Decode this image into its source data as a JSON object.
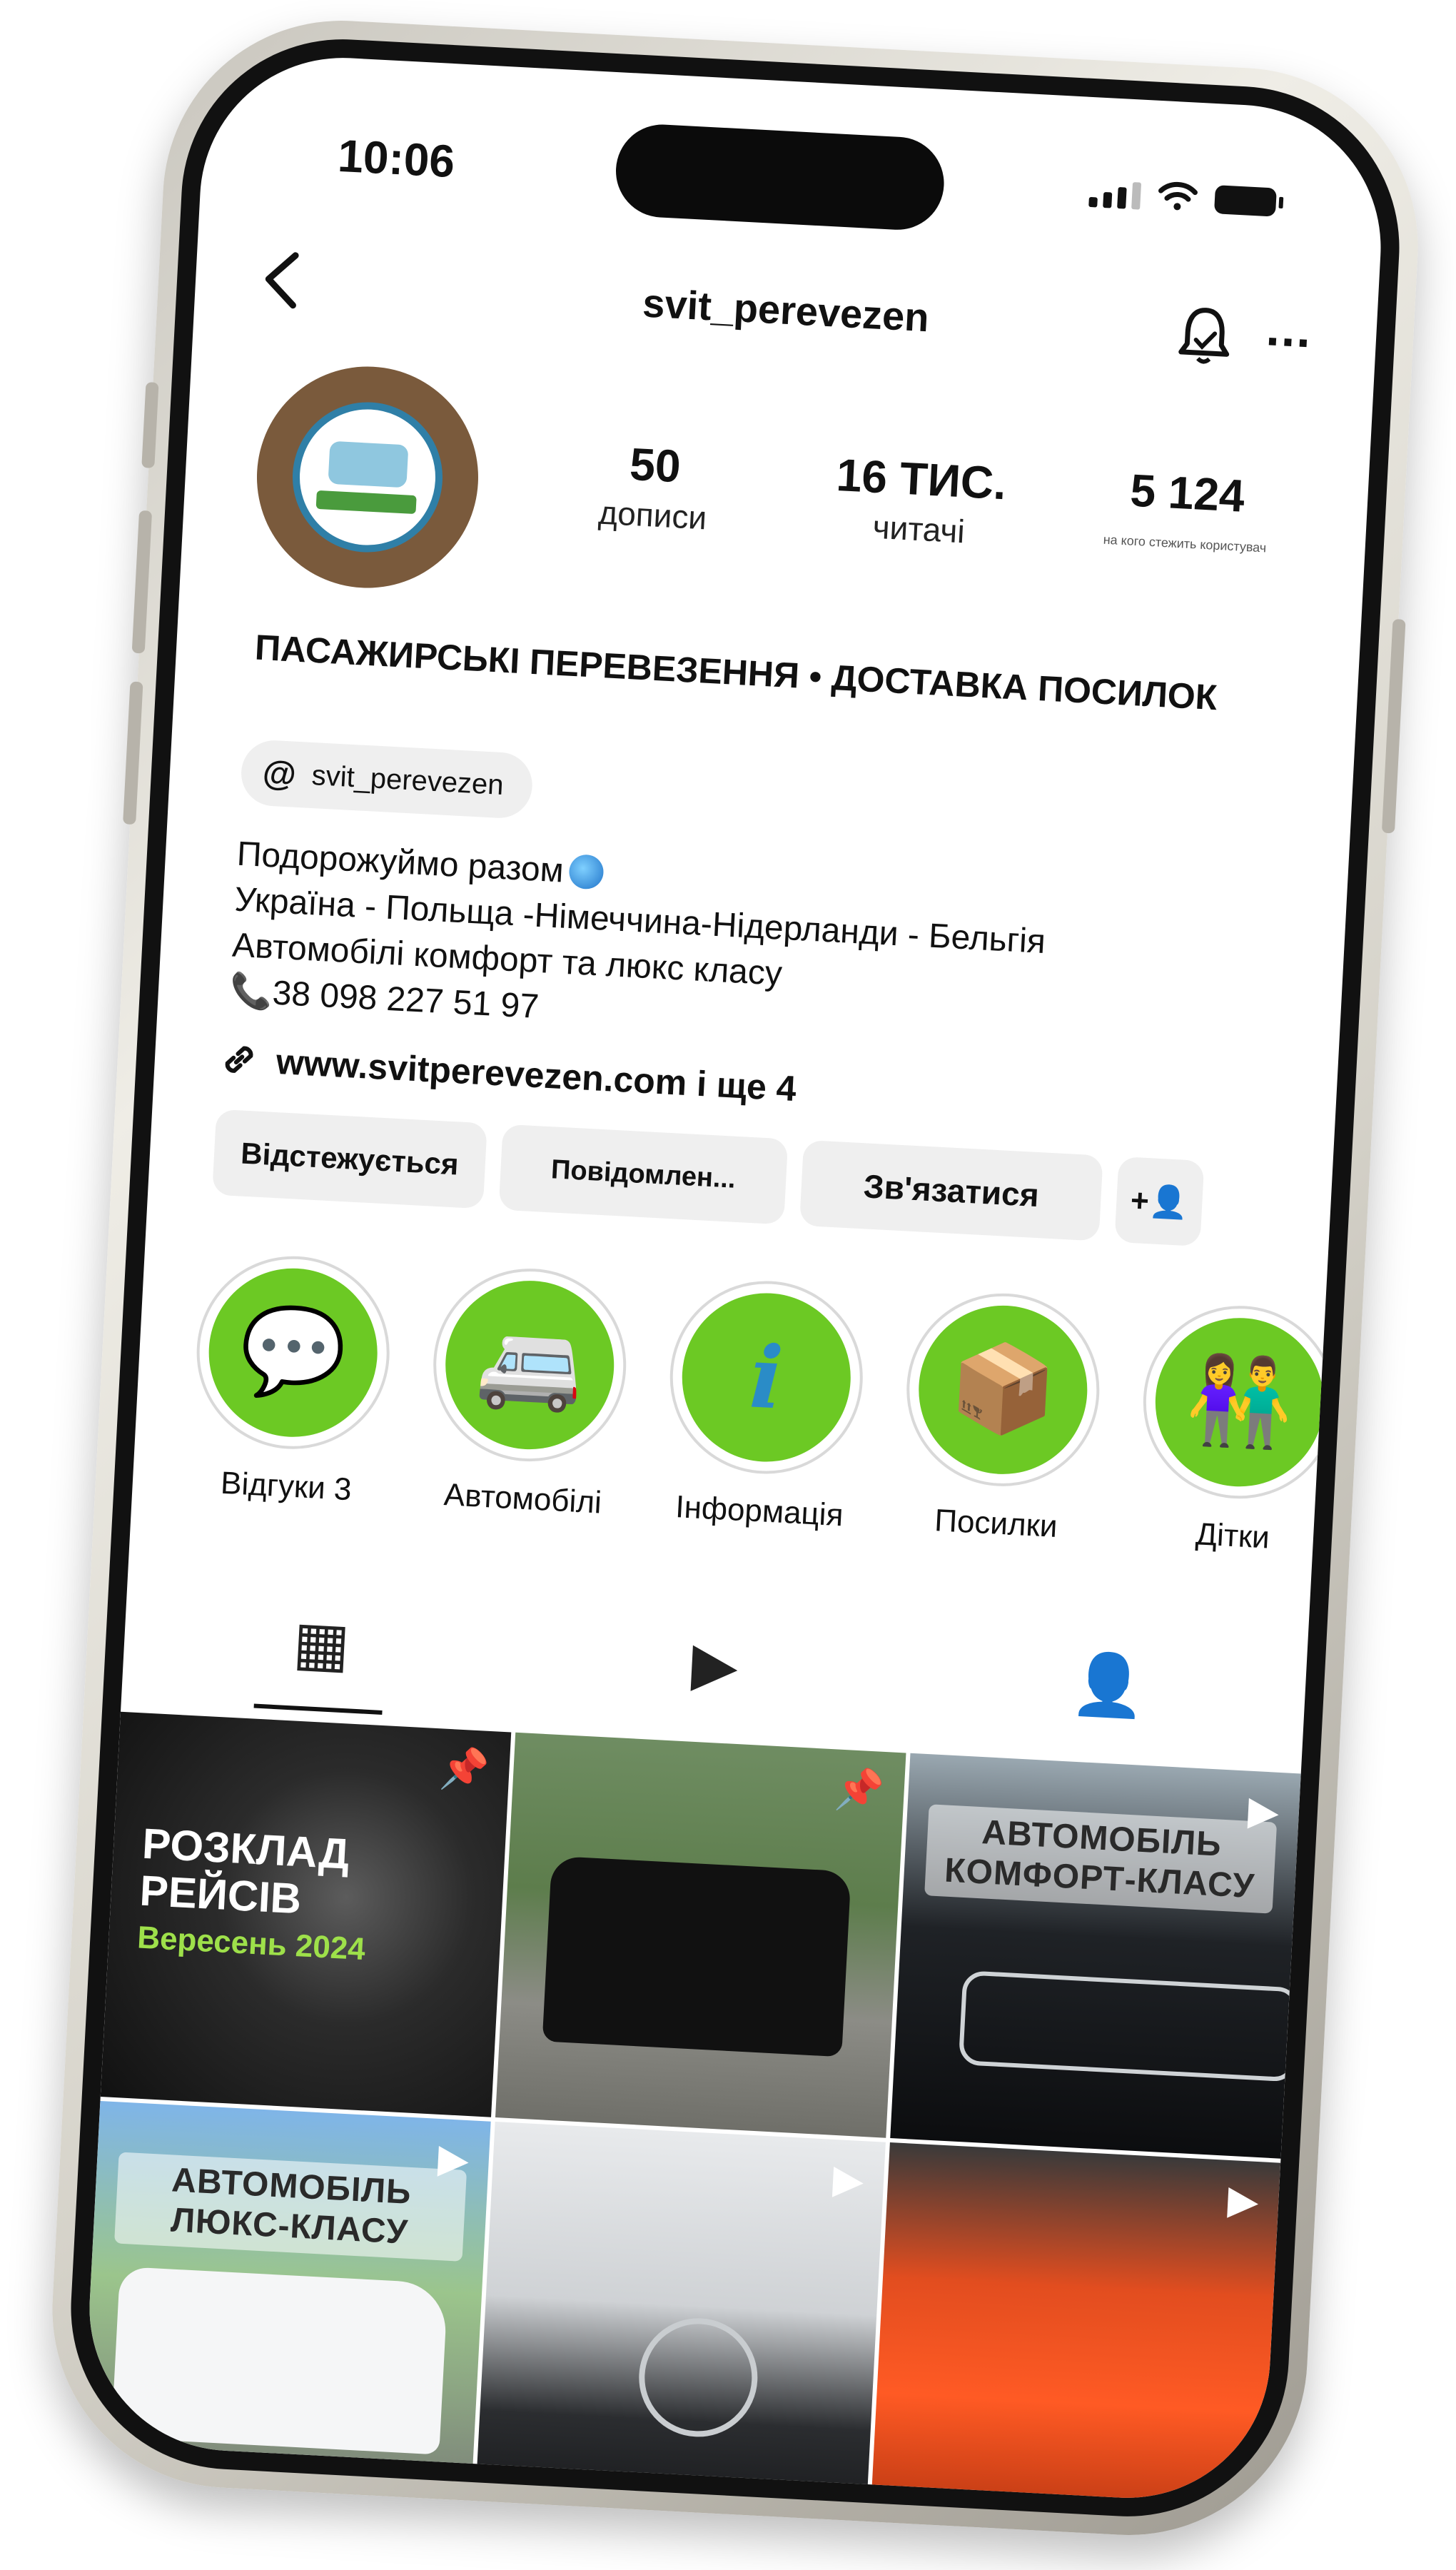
{
  "status_bar": {
    "time": "10:06"
  },
  "header": {
    "username": "svit_perevezen",
    "back_icon": "chevron-left-icon",
    "bell_icon": "bell-icon",
    "more_label": "..."
  },
  "stats": [
    {
      "value": "50",
      "label": "дописи"
    },
    {
      "value": "16 ТИС.",
      "label": "читачі"
    },
    {
      "value": "5 124",
      "label": "на кого стежить користувач"
    }
  ],
  "profile": {
    "name": "ПАСАЖИРСЬКІ ПЕРЕВЕЗЕННЯ • ДОСТАВКА ПОСИЛОК",
    "threads_handle": "svit_perevezen",
    "bio_lines": [
      "Подорожуймо разом",
      "Україна - Польща -Німеччина-Нідерланди - Бельгія",
      "Автомобілі комфорт та люкс класу",
      "📞38 098 227 51 97"
    ],
    "link": "www.svitperevezen.com і ще 4"
  },
  "buttons": {
    "following": "Відстежується",
    "message": "Повідомлен...",
    "contact": "Зв'язатися",
    "add_user": "+👤"
  },
  "highlights": [
    {
      "label": "Відгуки 3",
      "glyph": "💬"
    },
    {
      "label": "Автомобілі",
      "glyph": "🚐"
    },
    {
      "label": "Інформація",
      "glyph": "i"
    },
    {
      "label": "Посилки",
      "glyph": "📦"
    },
    {
      "label": "Дітки",
      "glyph": "👫"
    }
  ],
  "tabs": [
    {
      "name": "grid",
      "glyph": "▦"
    },
    {
      "name": "reels",
      "glyph": "▶"
    },
    {
      "name": "tagged",
      "glyph": "👤"
    }
  ],
  "posts": [
    {
      "title": "РОЗКЛАД\nРЕЙСІВ",
      "subtitle": "Вересень 2024",
      "badge": "📌"
    },
    {
      "badge": "📌"
    },
    {
      "label": "АВТОМОБІЛЬ\nКОМФОРТ-КЛАСУ",
      "badge": "▶"
    },
    {
      "label": "АВТОМОБІЛЬ\nЛЮКС-КЛАСУ",
      "badge": "▶"
    },
    {
      "badge": "▶"
    },
    {
      "badge": "▶"
    }
  ],
  "colors": {
    "highlight_green": "#6cc924",
    "button_gray": "#efefef",
    "text": "#111111"
  }
}
